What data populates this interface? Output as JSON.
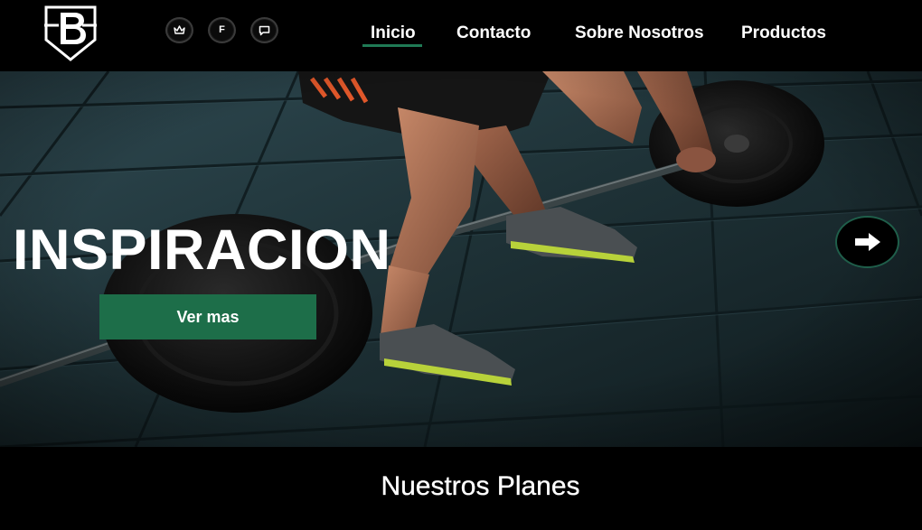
{
  "header": {
    "logo": {
      "letter": "B",
      "icon": "shield-b-logo"
    },
    "socials": [
      {
        "name": "crown-icon",
        "label": ""
      },
      {
        "name": "facebook-icon",
        "label": "F"
      },
      {
        "name": "chat-bubble-icon",
        "label": ""
      }
    ],
    "nav": [
      {
        "label": "Inicio",
        "active": true
      },
      {
        "label": "Contacto",
        "active": false
      },
      {
        "label": "Sobre Nosotros",
        "active": false
      },
      {
        "label": "Productos",
        "active": false
      }
    ]
  },
  "hero": {
    "title": "INSPIRACION",
    "button_label": "Ver mas",
    "next_icon": "arrow-right-icon",
    "photo": "athlete-deadlift-barbell"
  },
  "plans": {
    "title": "Nuestros Planes"
  },
  "colors": {
    "background": "#000000",
    "accent": "#1d6e49",
    "text": "#ffffff"
  }
}
